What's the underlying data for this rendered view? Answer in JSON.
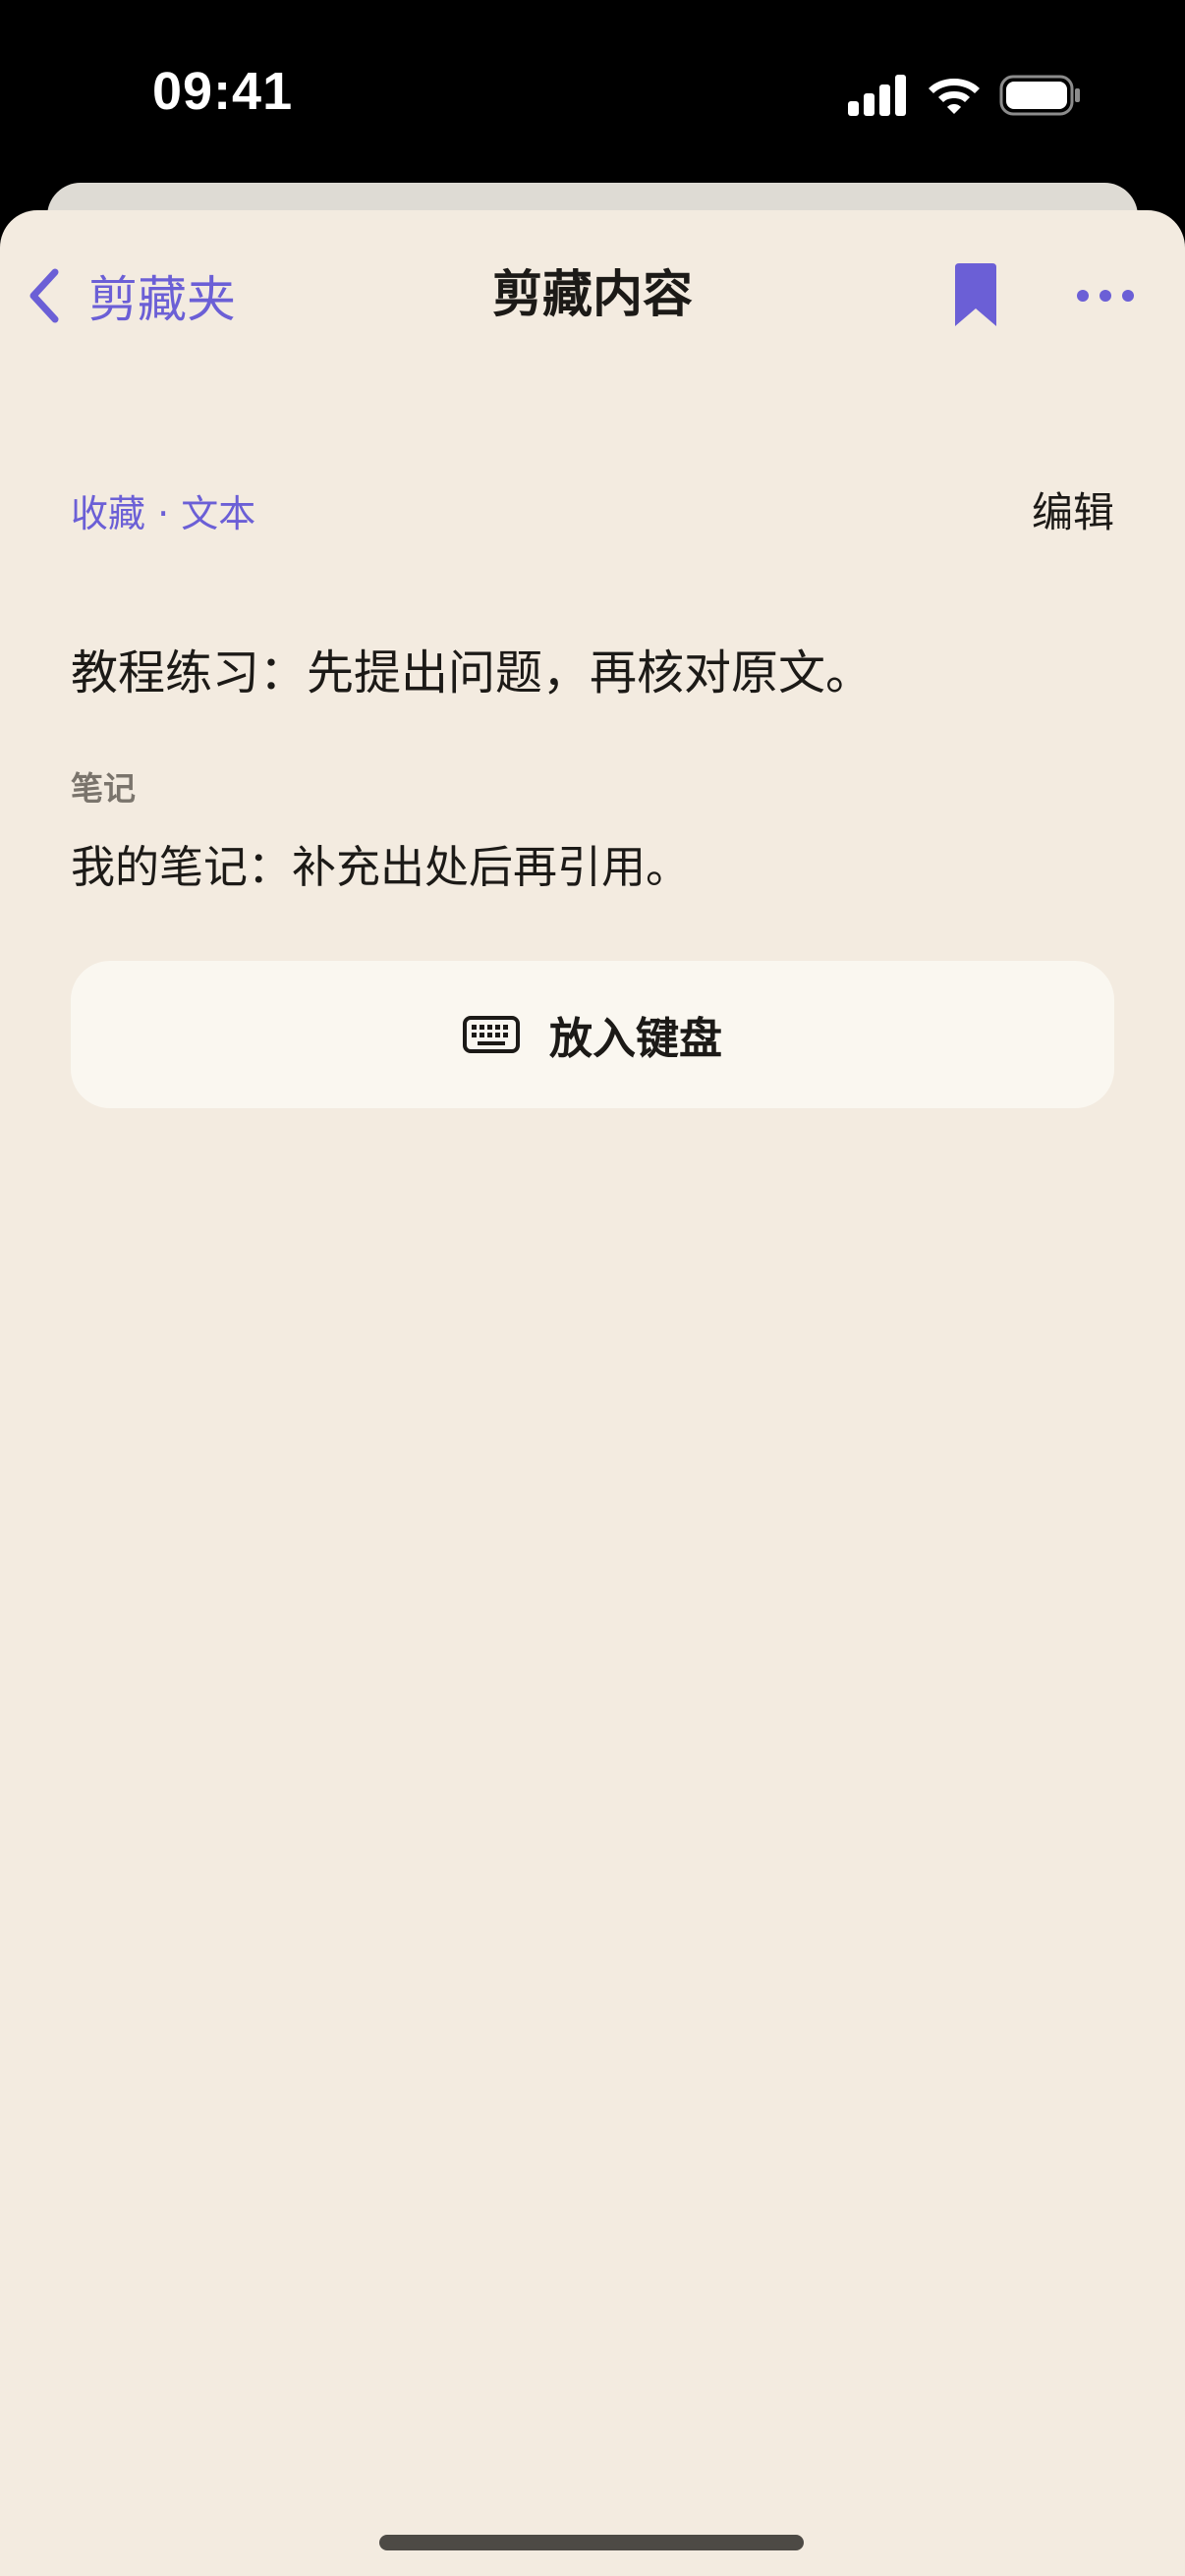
{
  "status_bar": {
    "time": "09:41"
  },
  "nav": {
    "back_label": "剪藏夹",
    "title": "剪藏内容",
    "bookmark_icon": "bookmark-filled-icon",
    "more_icon": "ellipsis-icon"
  },
  "clip": {
    "meta": "收藏 · 文本",
    "edit_label": "编辑",
    "text": "教程练习：先提出问题，再核对原文。",
    "note_heading": "笔记",
    "note_text": "我的笔记：补充出处后再引用。"
  },
  "actions": {
    "insert_keyboard_label": "放入键盘",
    "insert_keyboard_icon": "keyboard-icon"
  },
  "colors": {
    "accent": "#6b5fd6",
    "background": "#f3ebe0",
    "card": "#faf7f0",
    "text": "#1c1a17",
    "muted": "#7a746c"
  }
}
